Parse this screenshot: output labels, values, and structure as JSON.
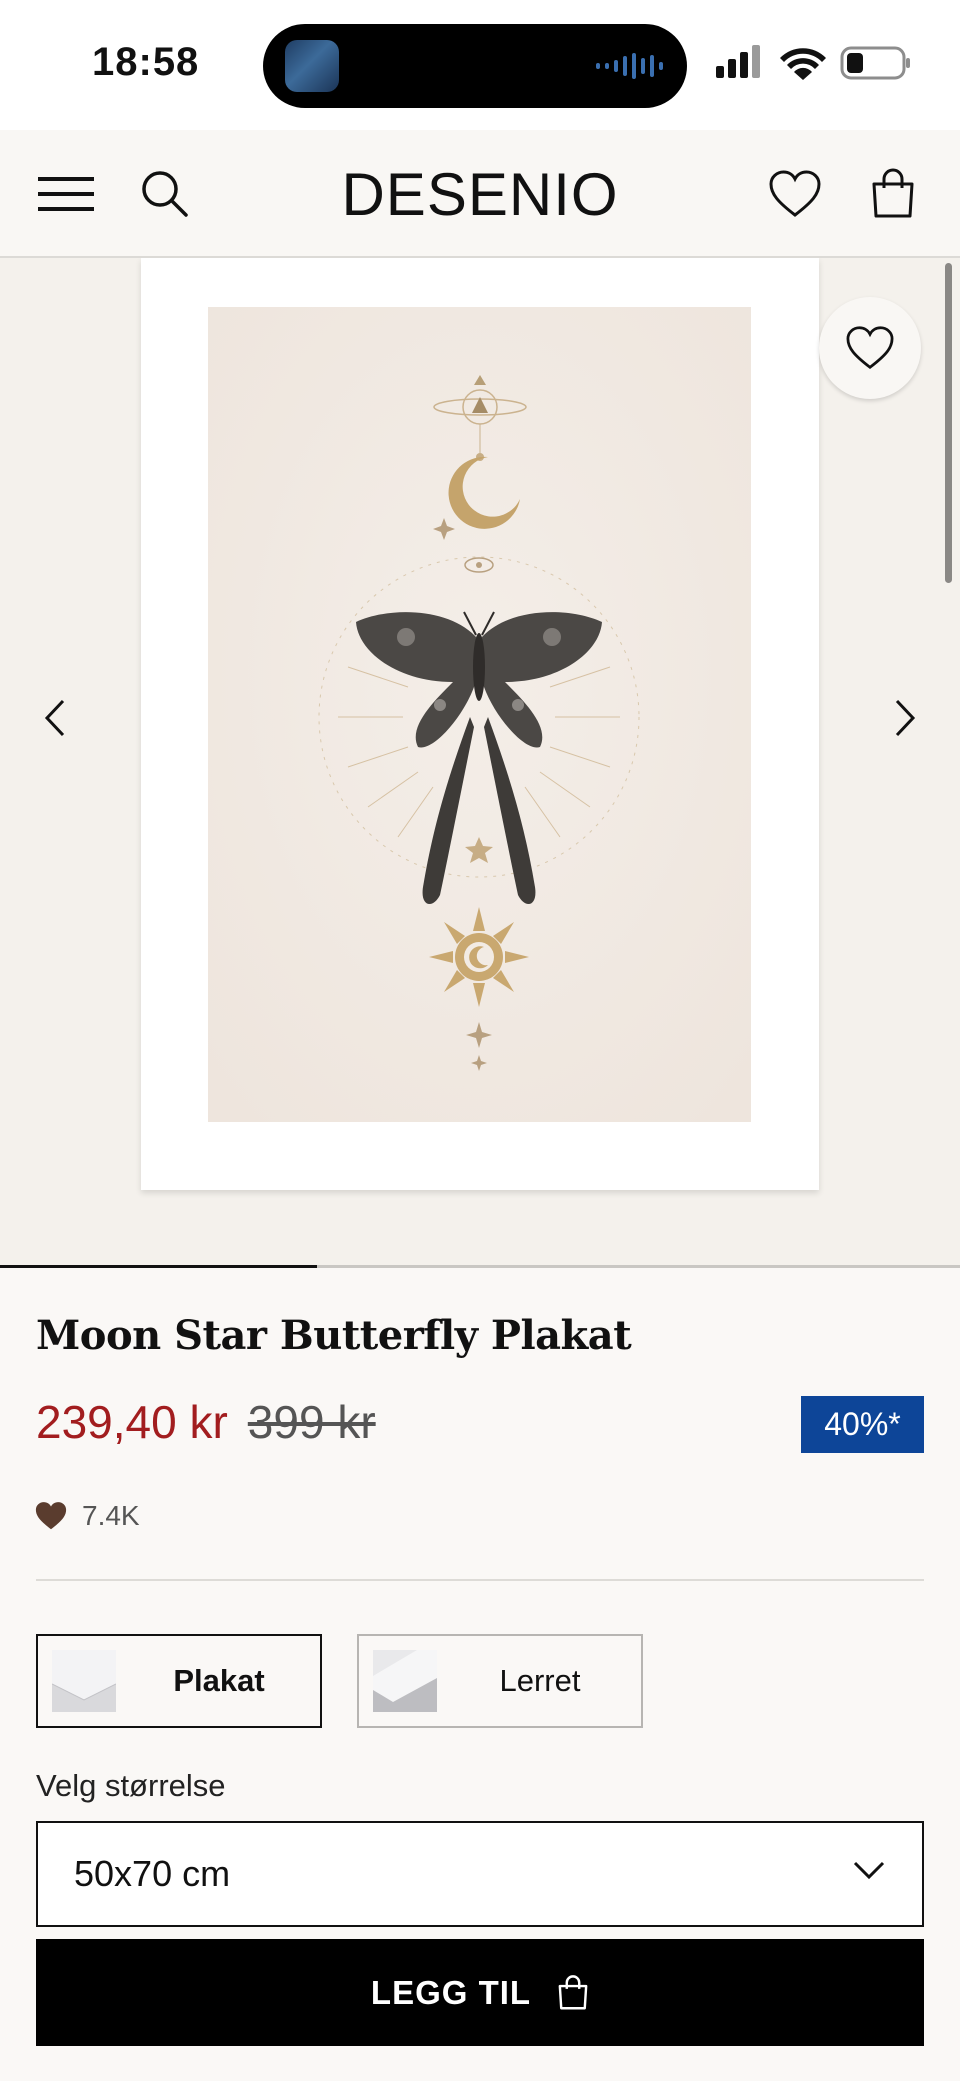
{
  "status_bar": {
    "time": "18:58"
  },
  "header": {
    "logo": "DESENIO",
    "icons": [
      "menu-icon",
      "search-icon",
      "heart-icon",
      "bag-icon"
    ]
  },
  "gallery": {
    "image_count_progress": 0.33
  },
  "product": {
    "title": "Moon Star Butterfly Plakat",
    "price_sale": "239,40 kr",
    "price_original": "399 kr",
    "discount_badge": "40%*",
    "likes": "7.4K"
  },
  "variants": [
    {
      "label": "Plakat",
      "selected": true
    },
    {
      "label": "Lerret",
      "selected": false
    }
  ],
  "size": {
    "label": "Velg størrelse",
    "selected": "50x70 cm"
  },
  "cta": {
    "label": "LEGG TIL"
  },
  "colors": {
    "sale_price": "#a21d1f",
    "badge_bg": "#0d4598",
    "cta_bg": "#000000"
  }
}
